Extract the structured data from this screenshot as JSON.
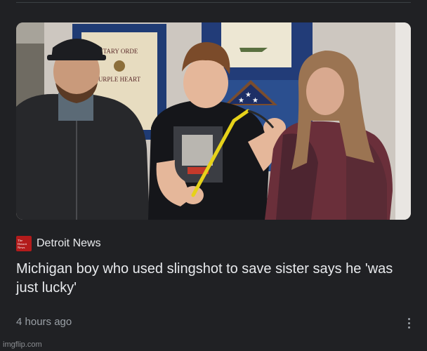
{
  "article": {
    "image": {
      "alt": "Boy holding a yellow slingshot standing between a man and a woman",
      "plaque_text": [
        "ITARY ORDE",
        "URPLE HEART"
      ]
    },
    "source": {
      "logo_text": [
        "The",
        "Detroit",
        "News"
      ],
      "name": "Detroit News"
    },
    "headline": "Michigan boy who used slingshot to save sister says he 'was just lucky'",
    "age": "4 hours ago",
    "menu_icon": "more-vert-icon"
  },
  "watermark": "imgflip.com",
  "colors": {
    "background": "#202124",
    "headline": "#e8eaed",
    "meta": "#9aa0a6",
    "logo": "#b31b1b",
    "slingshot": "#e6d21a"
  }
}
